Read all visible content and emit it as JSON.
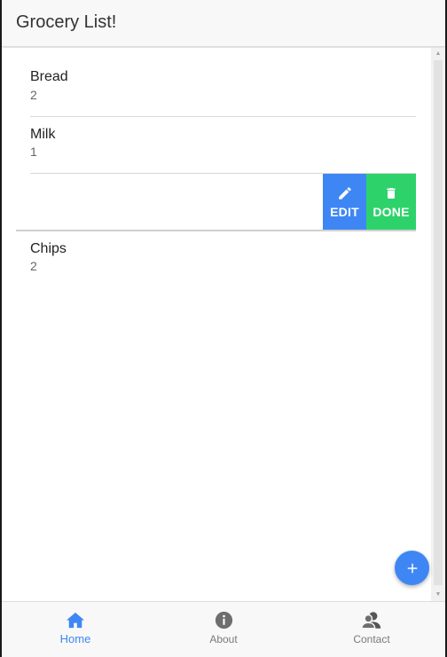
{
  "header": {
    "title": "Grocery List!"
  },
  "items": [
    {
      "name": "Bread",
      "quantity": "2"
    },
    {
      "name": "Milk",
      "quantity": "1"
    },
    {
      "name": "Chips",
      "quantity": "2"
    }
  ],
  "swipe_actions": {
    "edit_label": "EDIT",
    "done_label": "DONE"
  },
  "fab": {
    "icon": "plus-icon"
  },
  "tabs": [
    {
      "label": "Home",
      "icon": "home-icon",
      "active": true
    },
    {
      "label": "About",
      "icon": "info-icon",
      "active": false
    },
    {
      "label": "Contact",
      "icon": "contacts-icon",
      "active": false
    }
  ],
  "colors": {
    "accent": "#3f86f5",
    "done": "#2ed26b",
    "header_bg": "#f8f8f8"
  }
}
